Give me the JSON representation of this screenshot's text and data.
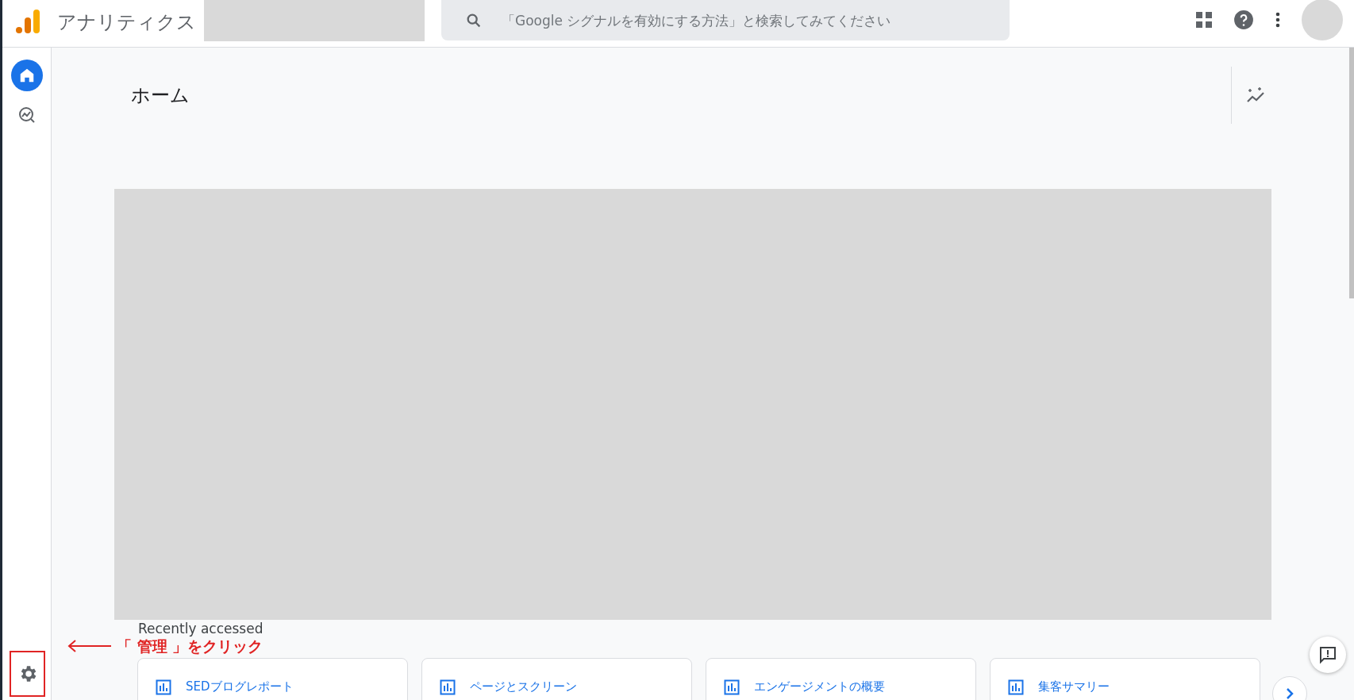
{
  "app": {
    "title": "アナリティクス"
  },
  "search": {
    "placeholder": "「Google シグナルを有効にする方法」と検索してみてください"
  },
  "nav": [
    {
      "kind": "home",
      "selected": true
    },
    {
      "kind": "reports",
      "selected": false
    }
  ],
  "page": {
    "title": "ホーム"
  },
  "recent": {
    "heading": "Recently accessed",
    "cards": [
      {
        "label": "SEDブログレポート"
      },
      {
        "label": "ページとスクリーン"
      },
      {
        "label": "エンゲージメントの概要"
      },
      {
        "label": "集客サマリー"
      }
    ]
  },
  "annotation": {
    "text": "「 管理 」をクリック"
  }
}
